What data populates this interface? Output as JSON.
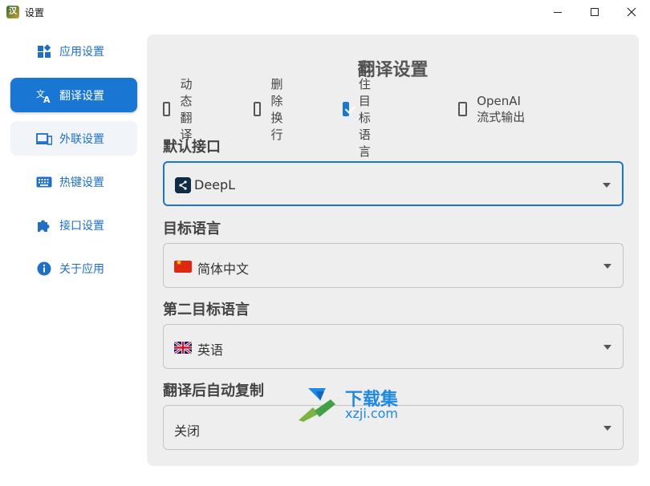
{
  "window": {
    "title": "设置",
    "app_icon_glyph": "汉"
  },
  "sidebar": {
    "items": [
      {
        "label": "应用设置",
        "icon": "widgets-icon"
      },
      {
        "label": "翻译设置",
        "icon": "translate-icon",
        "active": true
      },
      {
        "label": "外联设置",
        "icon": "devices-icon"
      },
      {
        "label": "热键设置",
        "icon": "keyboard-icon"
      },
      {
        "label": "接口设置",
        "icon": "puzzle-icon"
      },
      {
        "label": "关于应用",
        "icon": "info-icon"
      }
    ]
  },
  "main": {
    "title": "翻译设置",
    "checkboxes": [
      {
        "label": "动态翻译",
        "checked": false
      },
      {
        "label": "删除换行",
        "checked": false
      },
      {
        "label": "记住目标语言",
        "checked": true
      },
      {
        "label": "OpenAI 流式输出",
        "checked": false
      }
    ],
    "default_api": {
      "label": "默认接口",
      "value": "DeepL",
      "icon": "deepl-icon"
    },
    "target_language": {
      "label": "目标语言",
      "value": "简体中文",
      "icon": "flag-cn-icon"
    },
    "second_target_language": {
      "label": "第二目标语言",
      "value": "英语",
      "icon": "flag-uk-icon"
    },
    "auto_copy": {
      "label": "翻译后自动复制",
      "value": "关闭"
    }
  },
  "watermark": {
    "name": "下载集",
    "url": "xzji.com"
  },
  "colors": {
    "accent": "#1976d2",
    "panel_bg": "#eeeeee"
  }
}
